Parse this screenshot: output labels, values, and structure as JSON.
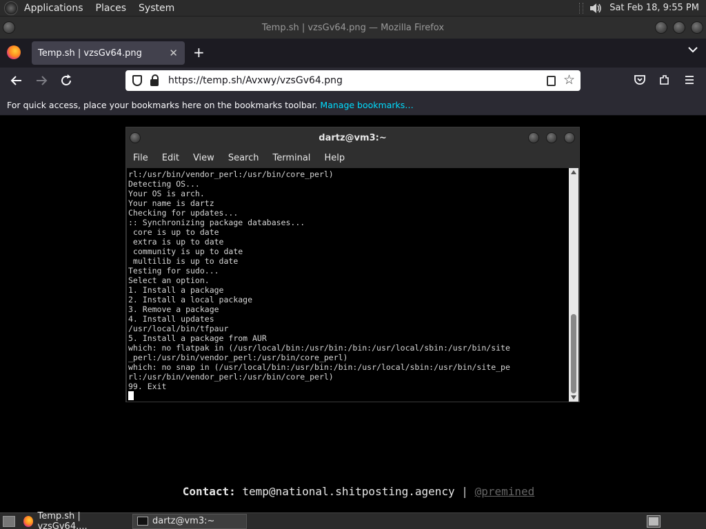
{
  "top_panel": {
    "menus": [
      "Applications",
      "Places",
      "System"
    ],
    "datetime": "Sat Feb 18,  9:55 PM",
    "icons": [
      "volume-icon"
    ]
  },
  "browser": {
    "window_title": "Temp.sh | vzsGv64.png — Mozilla Firefox",
    "tab_label": "Temp.sh | vzsGv64.png",
    "tab_close": "✕",
    "new_tab": "+",
    "url": "https://temp.sh/Avxwy/vzsGv64.png",
    "bookmarks_text": "For quick access, place your bookmarks here on the bookmarks toolbar.",
    "bookmarks_link": "Manage bookmarks…",
    "nav_icons": [
      "back-icon",
      "forward-icon",
      "reload-icon",
      "pocket-icon",
      "extensions-icon",
      "menu-icon"
    ]
  },
  "terminal": {
    "title": "dartz@vm3:~",
    "menu": [
      "File",
      "Edit",
      "View",
      "Search",
      "Terminal",
      "Help"
    ],
    "lines": [
      "rl:/usr/bin/vendor_perl:/usr/bin/core_perl)",
      "Detecting OS...",
      "Your OS is arch.",
      "Your name is dartz",
      "Checking for updates...",
      ":: Synchronizing package databases...",
      " core is up to date",
      " extra is up to date",
      " community is up to date",
      " multilib is up to date",
      "Testing for sudo...",
      "Select an option.",
      "1. Install a package",
      "2. Install a local package",
      "3. Remove a package",
      "4. Install updates",
      "/usr/local/bin/tfpaur",
      "5. Install a package from AUR",
      "which: no flatpak in (/usr/local/bin:/usr/bin:/bin:/usr/local/sbin:/usr/bin/site",
      "_perl:/usr/bin/vendor_perl:/usr/bin/core_perl)",
      "which: no snap in (/usr/local/bin:/usr/bin:/bin:/usr/local/sbin:/usr/bin/site_pe",
      "rl:/usr/bin/vendor_perl:/usr/bin/core_perl)",
      "99. Exit"
    ]
  },
  "contact": {
    "label": "Contact:",
    "email": "temp@national.shitposting.agency",
    "separator": "|",
    "handle": "@premined"
  },
  "taskbar": {
    "items": [
      {
        "label": "Temp.sh | vzsGv64....",
        "icon": "firefox-icon"
      },
      {
        "label": "dartz@vm3:~",
        "icon": "terminal-icon"
      }
    ]
  },
  "colors": {
    "tab_active": "#42414d",
    "toolbar": "#2b2a33",
    "link": "#00ddff",
    "terminal_bg": "#000000"
  }
}
